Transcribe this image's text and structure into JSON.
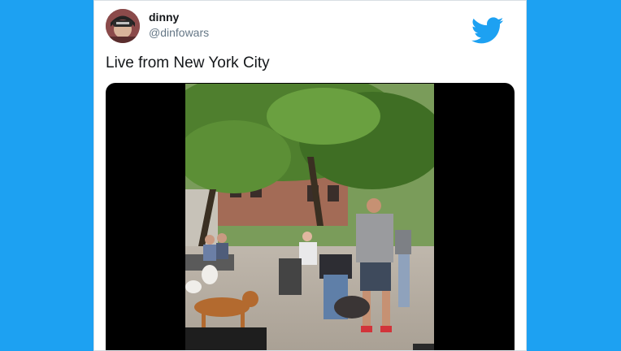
{
  "tweet": {
    "display_name": "dinny",
    "handle": "@dinfowars",
    "text": "Live from New York City"
  },
  "icons": {
    "platform_logo": "twitter-bird-icon",
    "avatar": "avatar-photo"
  },
  "media": {
    "type": "video-still",
    "description_icon": "video-frame"
  },
  "colors": {
    "background": "#1da1f2",
    "card": "#ffffff",
    "name": "#14171a",
    "handle": "#657786",
    "logo": "#1da1f2"
  }
}
